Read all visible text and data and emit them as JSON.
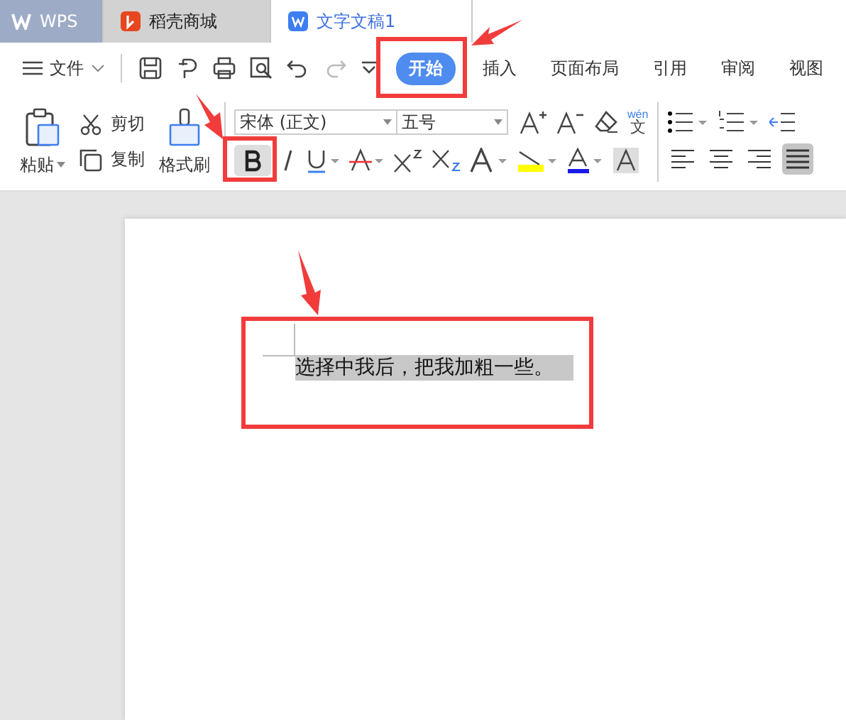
{
  "window_tabs": [
    {
      "label": "WPS",
      "kind": "home",
      "selected": false
    },
    {
      "label": "稻壳商城",
      "kind": "store",
      "selected": false
    },
    {
      "label": "文字文稿1",
      "kind": "doc",
      "selected": true
    }
  ],
  "menu": {
    "file_label": "文件"
  },
  "ribbon_tabs": [
    {
      "label": "开始",
      "selected": true
    },
    {
      "label": "插入",
      "selected": false
    },
    {
      "label": "页面布局",
      "selected": false
    },
    {
      "label": "引用",
      "selected": false
    },
    {
      "label": "审阅",
      "selected": false
    },
    {
      "label": "视图",
      "selected": false
    }
  ],
  "clipboard": {
    "paste": "粘贴",
    "cut": "剪切",
    "copy": "复制",
    "format_painter": "格式刷"
  },
  "font": {
    "name": "宋体 (正文)",
    "size": "五号",
    "phonetic_top": "wén",
    "phonetic_bottom": "文"
  },
  "bold": {
    "selected": true
  },
  "alignment": [
    {
      "selected": false
    },
    {
      "selected": false
    },
    {
      "selected": false
    },
    {
      "selected": true
    }
  ],
  "document": {
    "text": "选择中我后，把我加粗一些。",
    "highlighted": true
  }
}
